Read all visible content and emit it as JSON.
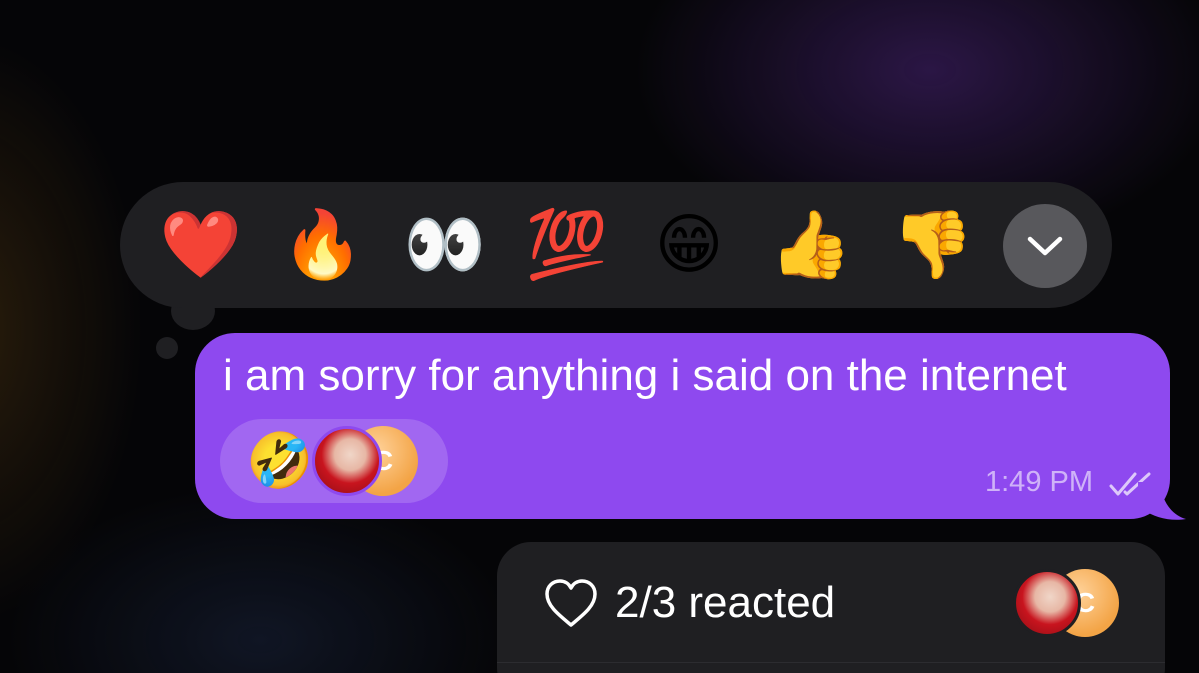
{
  "reaction_picker": {
    "emojis": [
      {
        "name": "red-heart",
        "glyph": "❤️"
      },
      {
        "name": "fire",
        "glyph": "🔥"
      },
      {
        "name": "eyes",
        "glyph": "👀"
      },
      {
        "name": "hundred-points",
        "glyph": "💯"
      },
      {
        "name": "grinning-face",
        "glyph": "😁"
      },
      {
        "name": "thumbs-up",
        "glyph": "👍"
      },
      {
        "name": "thumbs-down",
        "glyph": "👎"
      }
    ],
    "expand_icon": "chevron-down-icon"
  },
  "message": {
    "text": "i am sorry for anything i said on the internet",
    "time": "1:49 PM",
    "status_icon": "double-check-icon",
    "bubble_color": "#8e49ef",
    "reaction": {
      "glyph": "🤣",
      "name": "rolling-on-floor-laughing"
    },
    "reactor_initial": "C"
  },
  "reacted_bar": {
    "icon": "heart-outline-icon",
    "text": "2/3 reacted",
    "reactor_initial": "C"
  }
}
